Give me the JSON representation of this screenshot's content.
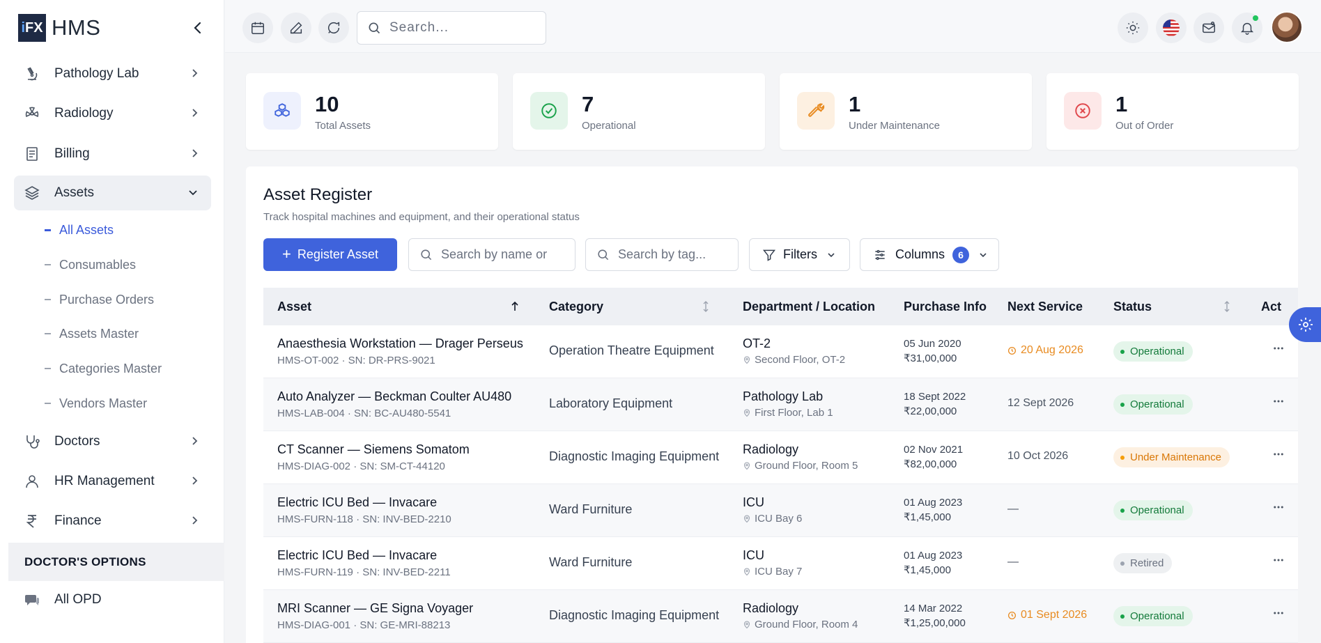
{
  "brand": {
    "name": "HMS",
    "logo_text": "iFX"
  },
  "sidebar": {
    "items": [
      {
        "label": "Pathology Lab",
        "icon": "microscope-icon"
      },
      {
        "label": "Radiology",
        "icon": "radiation-icon"
      },
      {
        "label": "Billing",
        "icon": "receipt-icon"
      },
      {
        "label": "Assets",
        "icon": "layers-icon",
        "expanded": true
      },
      {
        "label": "Doctors",
        "icon": "stethoscope-icon"
      },
      {
        "label": "HR Management",
        "icon": "user-icon"
      },
      {
        "label": "Finance",
        "icon": "rupee-icon"
      }
    ],
    "sub_items": [
      "All Assets",
      "Consumables",
      "Purchase Orders",
      "Assets Master",
      "Categories Master",
      "Vendors Master"
    ],
    "active_sub": "All Assets",
    "section_heading": "DOCTOR'S OPTIONS",
    "section_items": [
      {
        "label": "All OPD",
        "icon": "chat-icon"
      }
    ]
  },
  "topbar": {
    "search_placeholder": "Search..."
  },
  "stats": [
    {
      "value": "10",
      "caption": "Total Assets",
      "color": "#3f63dc",
      "bg": "#eef1fd"
    },
    {
      "value": "7",
      "caption": "Operational",
      "color": "#19a24a",
      "bg": "#e4f5ea"
    },
    {
      "value": "1",
      "caption": "Under Maintenance",
      "color": "#e88b21",
      "bg": "#fdf0e1"
    },
    {
      "value": "1",
      "caption": "Out of Order",
      "color": "#e0474c",
      "bg": "#fde8e8"
    }
  ],
  "register": {
    "title": "Asset Register",
    "subtitle": "Track hospital machines and equipment, and their operational status",
    "register_button": "Register Asset",
    "search_name_placeholder": "Search by name or",
    "search_tag_placeholder": "Search by tag...",
    "filters_label": "Filters",
    "columns_label": "Columns",
    "columns_count": "6",
    "headers": [
      "Asset",
      "Category",
      "Department / Location",
      "Purchase Info",
      "Next Service",
      "Status",
      "Act"
    ],
    "rows": [
      {
        "name": "Anaesthesia Workstation — Drager Perseus",
        "sub": "HMS-OT-002 · SN: DR-PRS-9021",
        "category": "Operation Theatre Equipment",
        "dept": "OT-2",
        "location": "Second Floor, OT-2",
        "date": "05 Jun 2020",
        "price": "₹31,00,000",
        "service": "20 Aug 2026",
        "service_warn": true,
        "status": "Operational",
        "status_type": "op"
      },
      {
        "name": "Auto Analyzer — Beckman Coulter AU480",
        "sub": "HMS-LAB-004 · SN: BC-AU480-5541",
        "category": "Laboratory Equipment",
        "dept": "Pathology Lab",
        "location": "First Floor, Lab 1",
        "date": "18 Sept 2022",
        "price": "₹22,00,000",
        "service": "12 Sept 2026",
        "service_warn": false,
        "status": "Operational",
        "status_type": "op"
      },
      {
        "name": "CT Scanner — Siemens Somatom",
        "sub": "HMS-DIAG-002 · SN: SM-CT-44120",
        "category": "Diagnostic Imaging Equipment",
        "dept": "Radiology",
        "location": "Ground Floor, Room 5",
        "date": "02 Nov 2021",
        "price": "₹82,00,000",
        "service": "10 Oct 2026",
        "service_warn": false,
        "status": "Under Maintenance",
        "status_type": "mt"
      },
      {
        "name": "Electric ICU Bed — Invacare",
        "sub": "HMS-FURN-118 · SN: INV-BED-2210",
        "category": "Ward Furniture",
        "dept": "ICU",
        "location": "ICU Bay 6",
        "date": "01 Aug 2023",
        "price": "₹1,45,000",
        "service": "—",
        "service_warn": false,
        "status": "Operational",
        "status_type": "op"
      },
      {
        "name": "Electric ICU Bed — Invacare",
        "sub": "HMS-FURN-119 · SN: INV-BED-2211",
        "category": "Ward Furniture",
        "dept": "ICU",
        "location": "ICU Bay 7",
        "date": "01 Aug 2023",
        "price": "₹1,45,000",
        "service": "—",
        "service_warn": false,
        "status": "Retired",
        "status_type": "rt"
      },
      {
        "name": "MRI Scanner — GE Signa Voyager",
        "sub": "HMS-DIAG-001 · SN: GE-MRI-88213",
        "category": "Diagnostic Imaging Equipment",
        "dept": "Radiology",
        "location": "Ground Floor, Room 4",
        "date": "14 Mar 2022",
        "price": "₹1,25,00,000",
        "service": "01 Sept 2026",
        "service_warn": true,
        "status": "Operational",
        "status_type": "op"
      }
    ]
  }
}
